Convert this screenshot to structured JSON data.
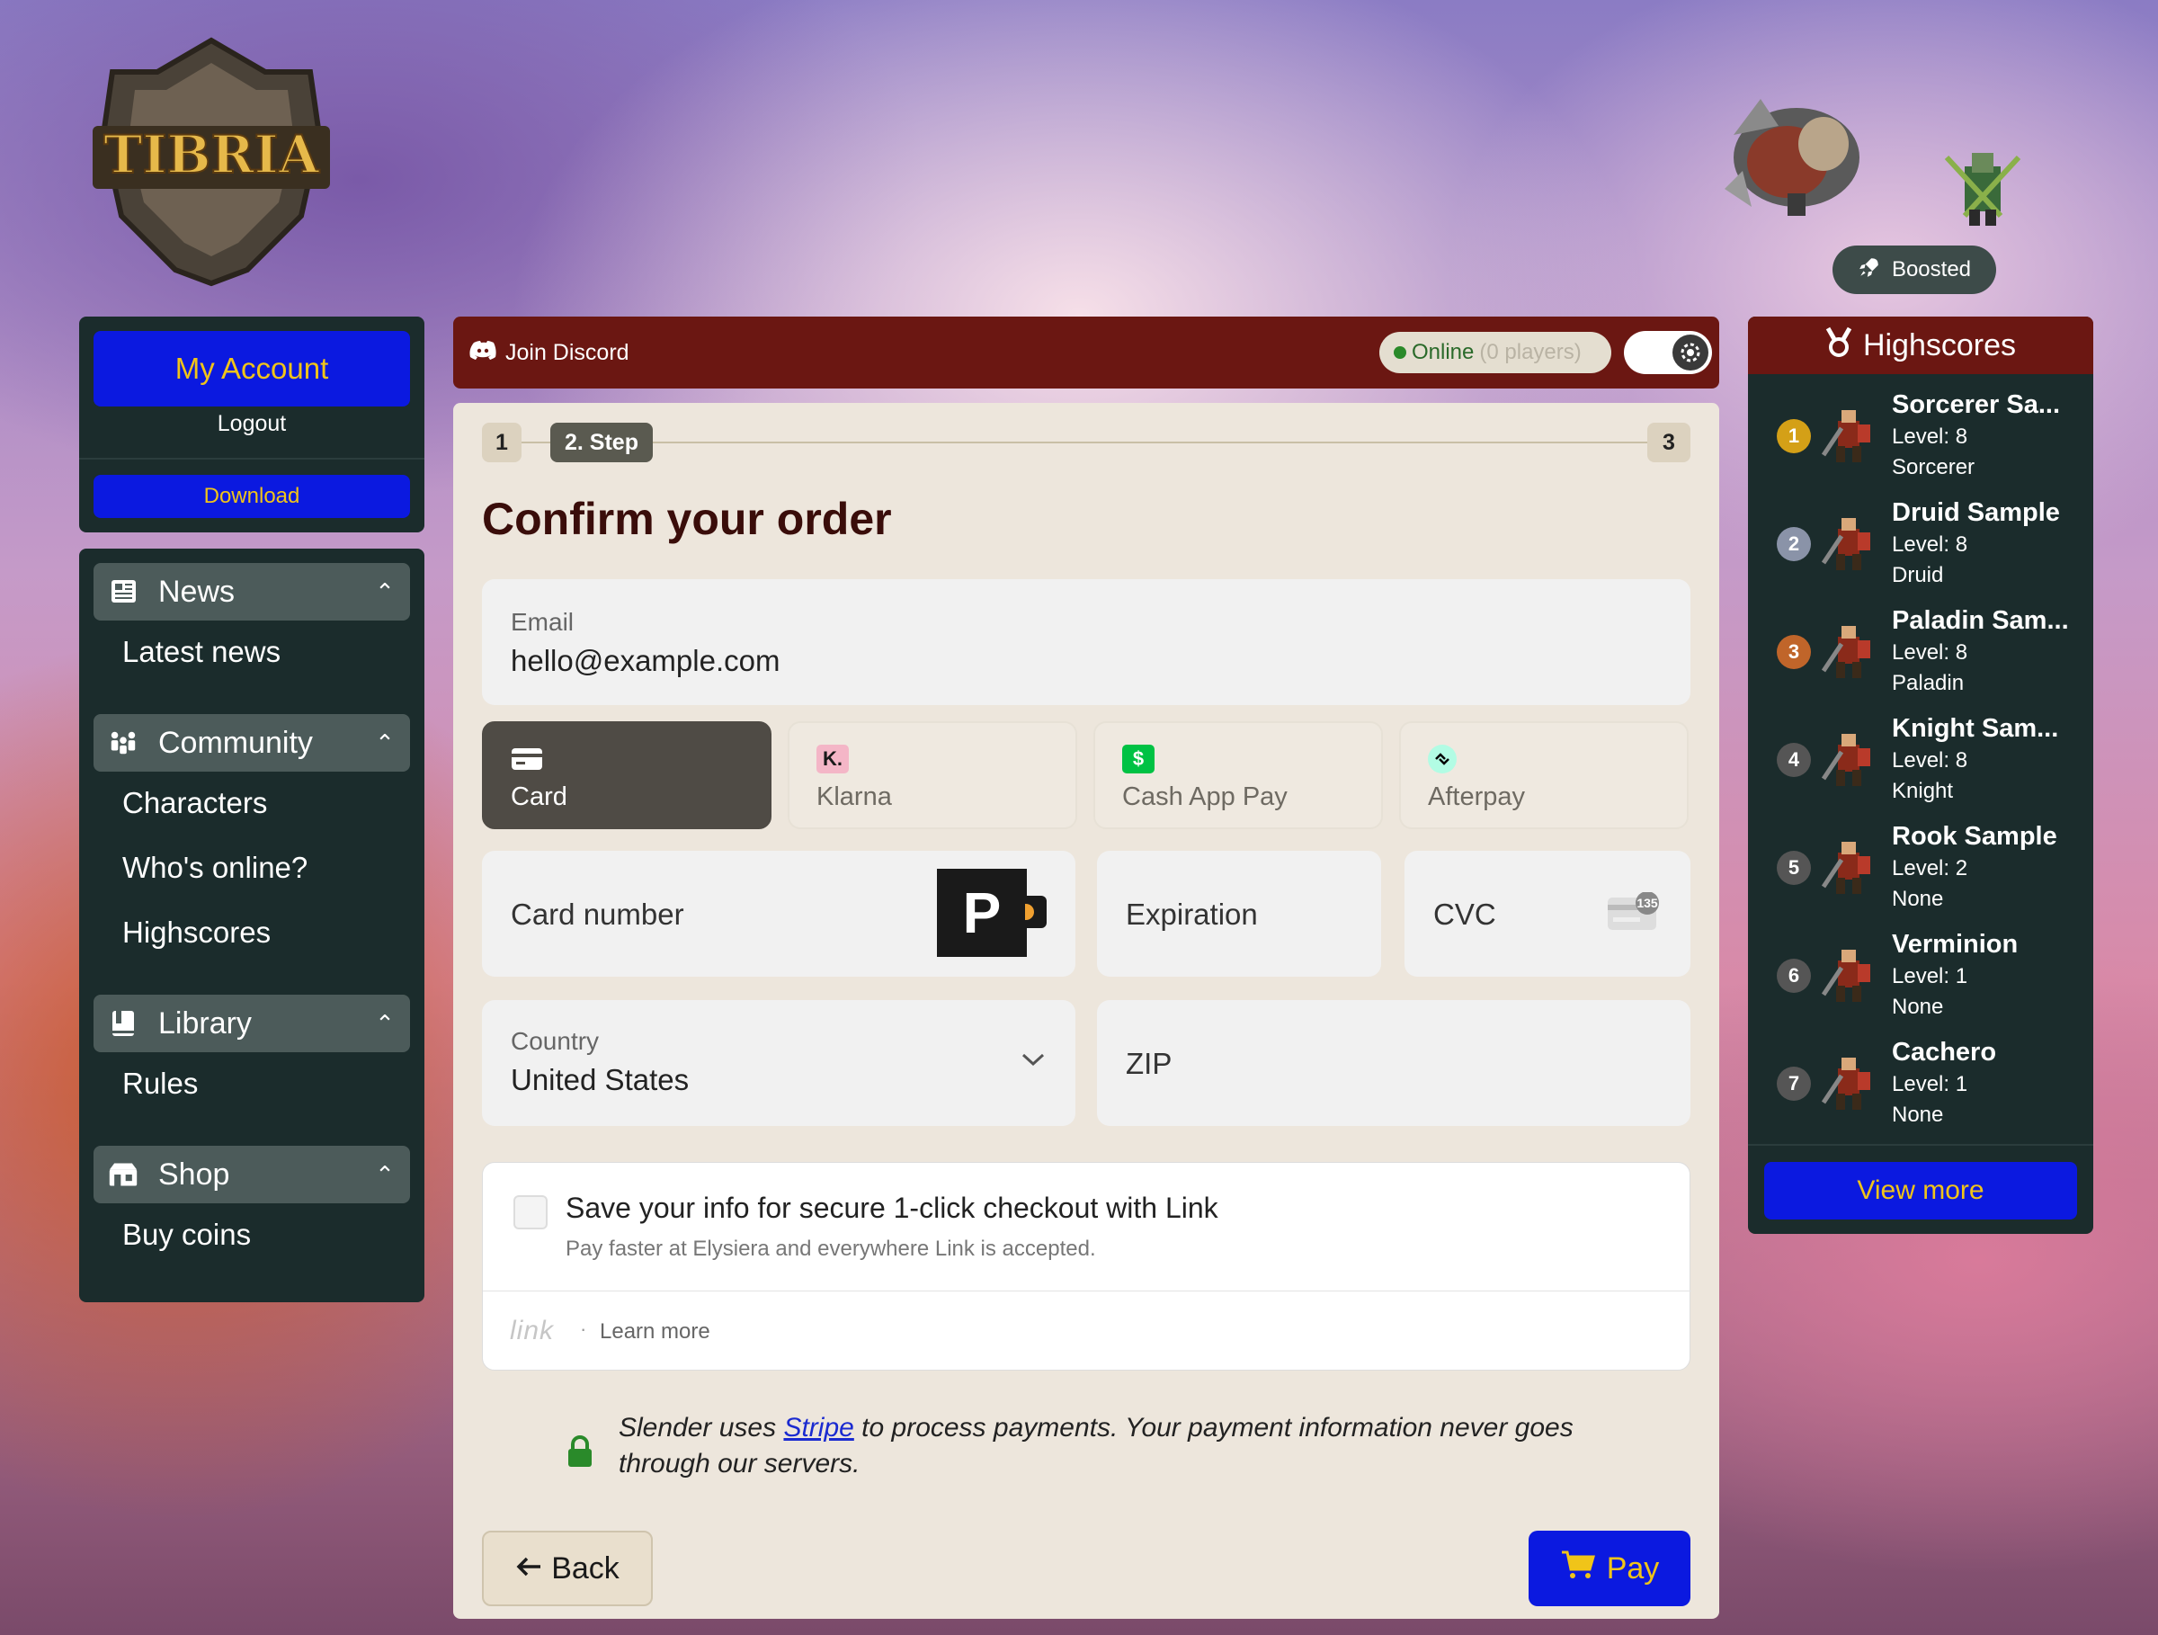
{
  "logo": {
    "text": "TIBRIA"
  },
  "boosted": {
    "label": "Boosted"
  },
  "account": {
    "my_account": "My Account",
    "logout": "Logout",
    "download": "Download"
  },
  "menu": {
    "sections": [
      {
        "label": "News",
        "items": [
          "Latest news"
        ]
      },
      {
        "label": "Community",
        "items": [
          "Characters",
          "Who's online?",
          "Highscores"
        ]
      },
      {
        "label": "Library",
        "items": [
          "Rules"
        ]
      },
      {
        "label": "Shop",
        "items": [
          "Buy coins"
        ]
      }
    ]
  },
  "topbar": {
    "discord": "Join Discord",
    "online": "Online",
    "players": "(0 players)"
  },
  "stepper": {
    "step1": "1",
    "step2": "2. Step",
    "step3": "3"
  },
  "order": {
    "title": "Confirm your order",
    "email_label": "Email",
    "email_value": "hello@example.com",
    "tabs": [
      {
        "label": "Card",
        "icon": "card-icon",
        "active": true
      },
      {
        "label": "Klarna",
        "icon": "klarna-icon",
        "icon_text": "K.",
        "active": false
      },
      {
        "label": "Cash App Pay",
        "icon": "cashapp-icon",
        "icon_text": "$",
        "active": false
      },
      {
        "label": "Afterpay",
        "icon": "afterpay-icon",
        "active": false
      }
    ],
    "card_number": "Card number",
    "expiration": "Expiration",
    "cvc": "CVC",
    "cvc_badge": "135",
    "country_label": "Country",
    "country_value": "United States",
    "zip": "ZIP",
    "p_badge": "P"
  },
  "link": {
    "title": "Save your info for secure 1-click checkout with Link",
    "subtitle": "Pay faster at Elysiera and everywhere Link is accepted.",
    "logo": "link",
    "dot": "·",
    "learn_more": "Learn more"
  },
  "stripe_note": {
    "before": "Slender uses ",
    "link": "Stripe",
    "after": " to process payments. Your payment information never goes through our servers."
  },
  "buttons": {
    "back": "Back",
    "pay": "Pay"
  },
  "highscores": {
    "title": "Highscores",
    "view_more": "View more",
    "entries": [
      {
        "rank": "1",
        "name": "Sorcerer Sa...",
        "level": "Level: 8",
        "vocation": "Sorcerer",
        "color": "#d4a017"
      },
      {
        "rank": "2",
        "name": "Druid Sample",
        "level": "Level: 8",
        "vocation": "Druid",
        "color": "#8a93a8"
      },
      {
        "rank": "3",
        "name": "Paladin Sam...",
        "level": "Level: 8",
        "vocation": "Paladin",
        "color": "#c0652a"
      },
      {
        "rank": "4",
        "name": "Knight Sam...",
        "level": "Level: 8",
        "vocation": "Knight",
        "color": "#555555"
      },
      {
        "rank": "5",
        "name": "Rook Sample",
        "level": "Level: 2",
        "vocation": "None",
        "color": "#555555"
      },
      {
        "rank": "6",
        "name": "Verminion",
        "level": "Level: 1",
        "vocation": "None",
        "color": "#555555"
      },
      {
        "rank": "7",
        "name": "Cachero",
        "level": "Level: 1",
        "vocation": "None",
        "color": "#555555"
      }
    ]
  },
  "colors": {
    "accent_blue": "#0b19e0",
    "accent_gold": "#f0c419",
    "dark_panel": "#1b2c2c",
    "topbar_red": "#6b1712"
  }
}
